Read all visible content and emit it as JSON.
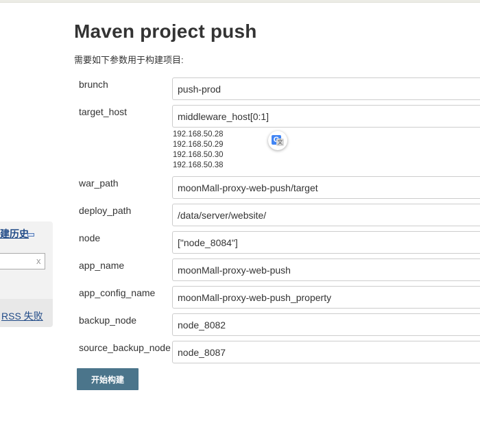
{
  "sidebar": {
    "history_title": "建历史",
    "rss_failed_link": "RSS 失败",
    "filter_clear_glyph": "x"
  },
  "page": {
    "title": "Maven project push",
    "description": "需要如下参数用于构建项目:"
  },
  "params": [
    {
      "label": "brunch",
      "value": "push-prod"
    },
    {
      "label": "target_host",
      "value": "middleware_host[0:1]"
    },
    {
      "label": "war_path",
      "value": "moonMall-proxy-web-push/target"
    },
    {
      "label": "deploy_path",
      "value": "/data/server/website/"
    },
    {
      "label": "node",
      "value": "[\"node_8084\"]"
    },
    {
      "label": "app_name",
      "value": "moonMall-proxy-web-push"
    },
    {
      "label": "app_config_name",
      "value": "moonMall-proxy-web-push_property"
    },
    {
      "label": "backup_node",
      "value": "node_8082"
    },
    {
      "label": "source_backup_node",
      "value": "node_8087"
    }
  ],
  "target_host_hint": [
    "192.168.50.28",
    "192.168.50.29",
    "192.168.50.30",
    "192.168.50.38"
  ],
  "build_button_label": "开始构建",
  "icons": {
    "translate": "google-translate-icon",
    "collapse": "collapse-minus-icon",
    "clear": "clear-x-icon"
  },
  "colors": {
    "link": "#204a87",
    "button_bg": "#4b758b",
    "panel_bg": "#f2f2f2"
  }
}
